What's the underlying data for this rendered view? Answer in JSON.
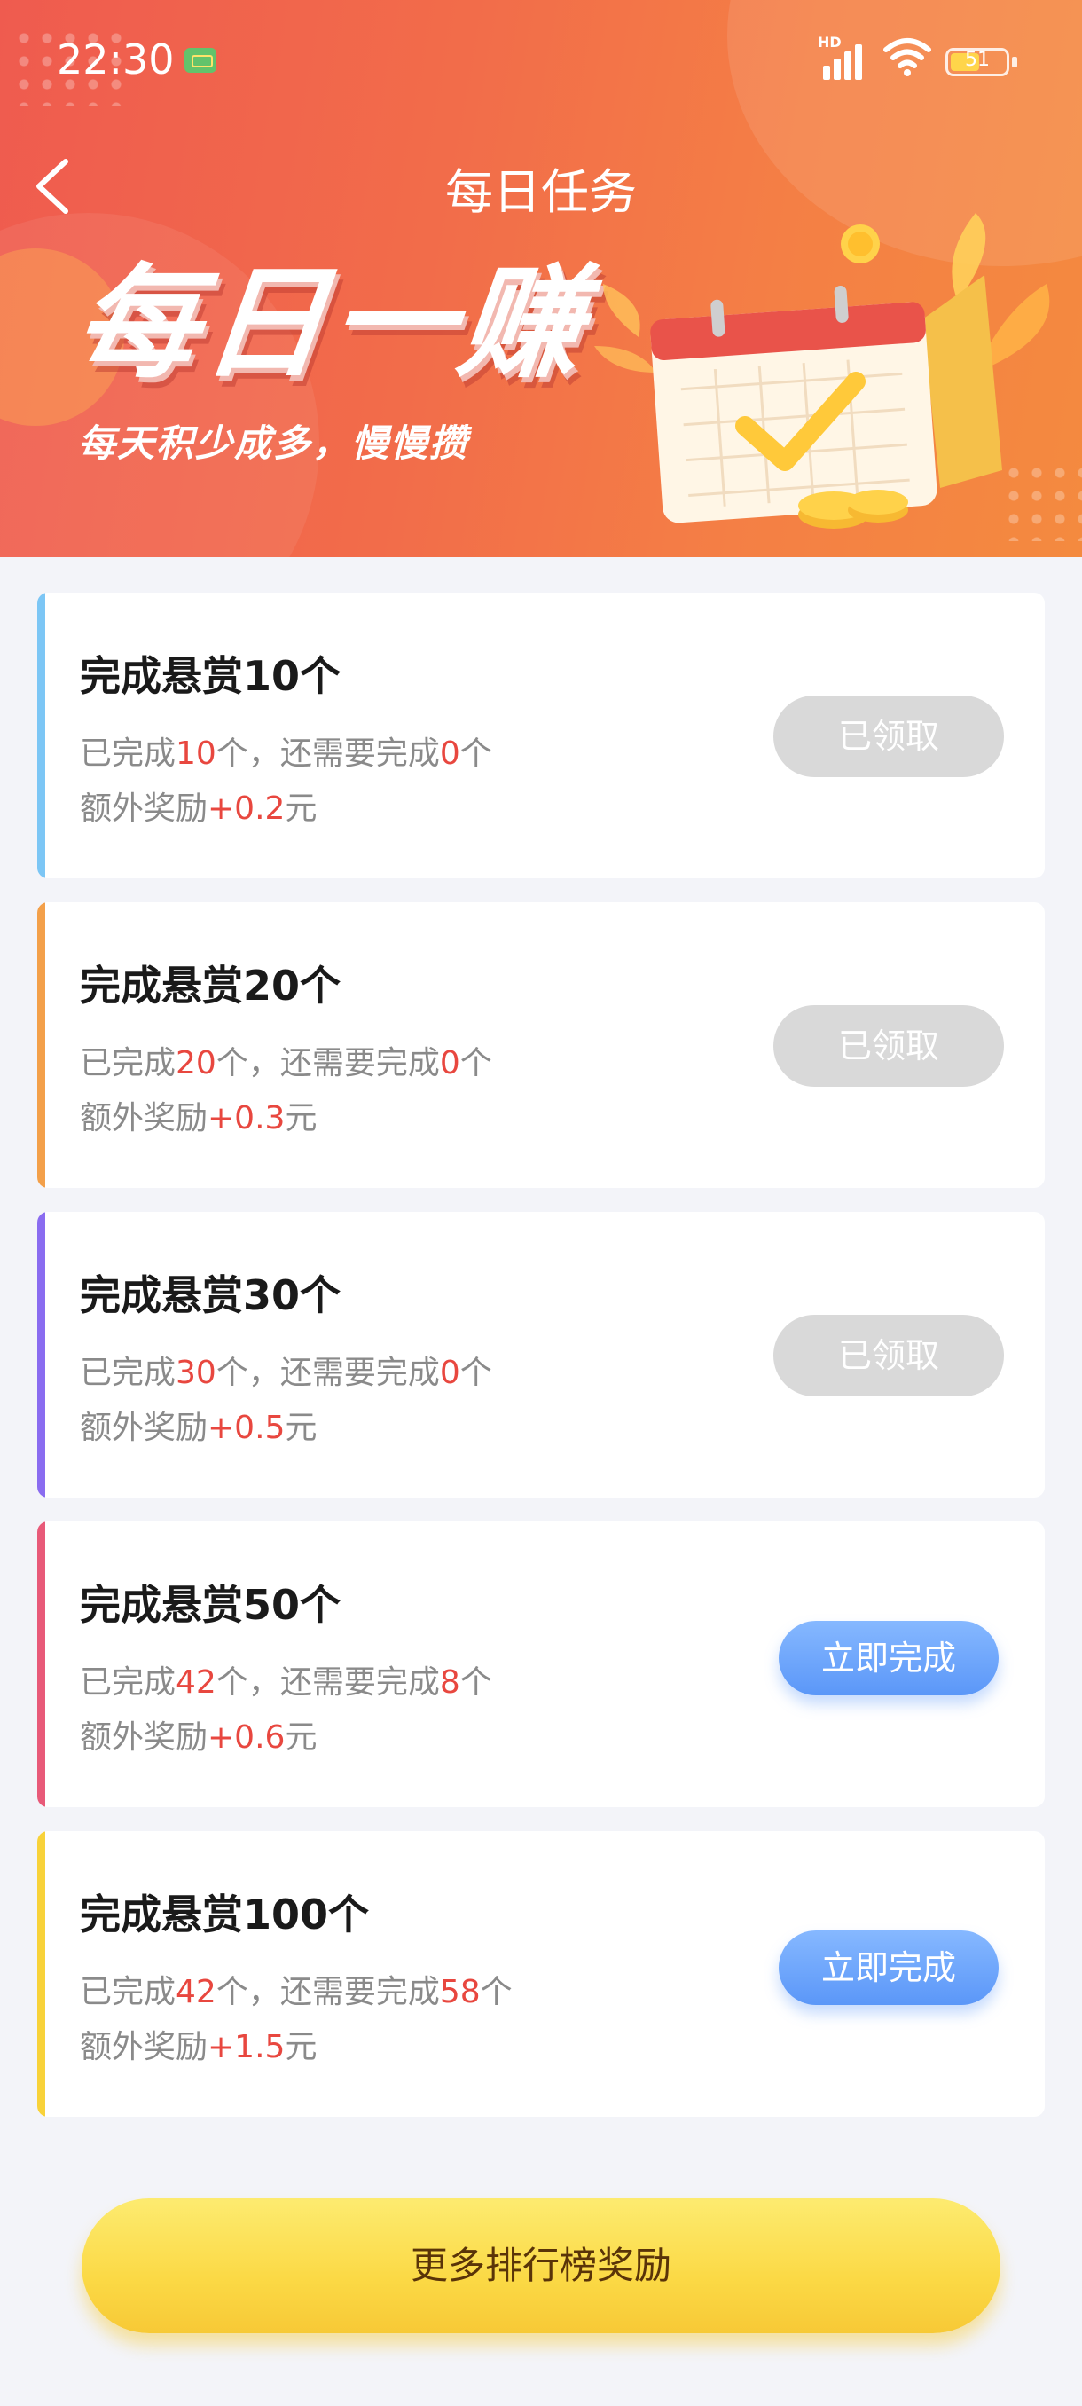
{
  "status_bar": {
    "time": "22:30",
    "network": "HD",
    "battery": "51"
  },
  "nav": {
    "title": "每日任务"
  },
  "hero": {
    "title": "每日一赚",
    "subtitle": "每天积少成多，慢慢攒"
  },
  "colors": {
    "header": "#f26c4a",
    "highlight": "#e8473f",
    "blue_button": "#5b97f8",
    "gold_button": "#fbd945"
  },
  "tasks": [
    {
      "title": "完成悬赏10个",
      "p_pre": "已完成",
      "done": "10",
      "p_mid": "个，还需要完成",
      "left": "0",
      "p_suf": "个",
      "r_pre": "额外奖励",
      "reward": "+0.2",
      "r_suf": "元",
      "button": "已领取",
      "status": "claimed",
      "accent": "#7cc6f5"
    },
    {
      "title": "完成悬赏20个",
      "p_pre": "已完成",
      "done": "20",
      "p_mid": "个，还需要完成",
      "left": "0",
      "p_suf": "个",
      "r_pre": "额外奖励",
      "reward": "+0.3",
      "r_suf": "元",
      "button": "已领取",
      "status": "claimed",
      "accent": "#f3a04a"
    },
    {
      "title": "完成悬赏30个",
      "p_pre": "已完成",
      "done": "30",
      "p_mid": "个，还需要完成",
      "left": "0",
      "p_suf": "个",
      "r_pre": "额外奖励",
      "reward": "+0.5",
      "r_suf": "元",
      "button": "已领取",
      "status": "claimed",
      "accent": "#8a6cf0"
    },
    {
      "title": "完成悬赏50个",
      "p_pre": "已完成",
      "done": "42",
      "p_mid": "个，还需要完成",
      "left": "8",
      "p_suf": "个",
      "r_pre": "额外奖励",
      "reward": "+0.6",
      "r_suf": "元",
      "button": "立即完成",
      "status": "todo",
      "accent": "#e85a79"
    },
    {
      "title": "完成悬赏100个",
      "p_pre": "已完成",
      "done": "42",
      "p_mid": "个，还需要完成",
      "left": "58",
      "p_suf": "个",
      "r_pre": "额外奖励",
      "reward": "+1.5",
      "r_suf": "元",
      "button": "立即完成",
      "status": "todo",
      "accent": "#f8d23a"
    }
  ],
  "footer": {
    "button": "更多排行榜奖励"
  }
}
